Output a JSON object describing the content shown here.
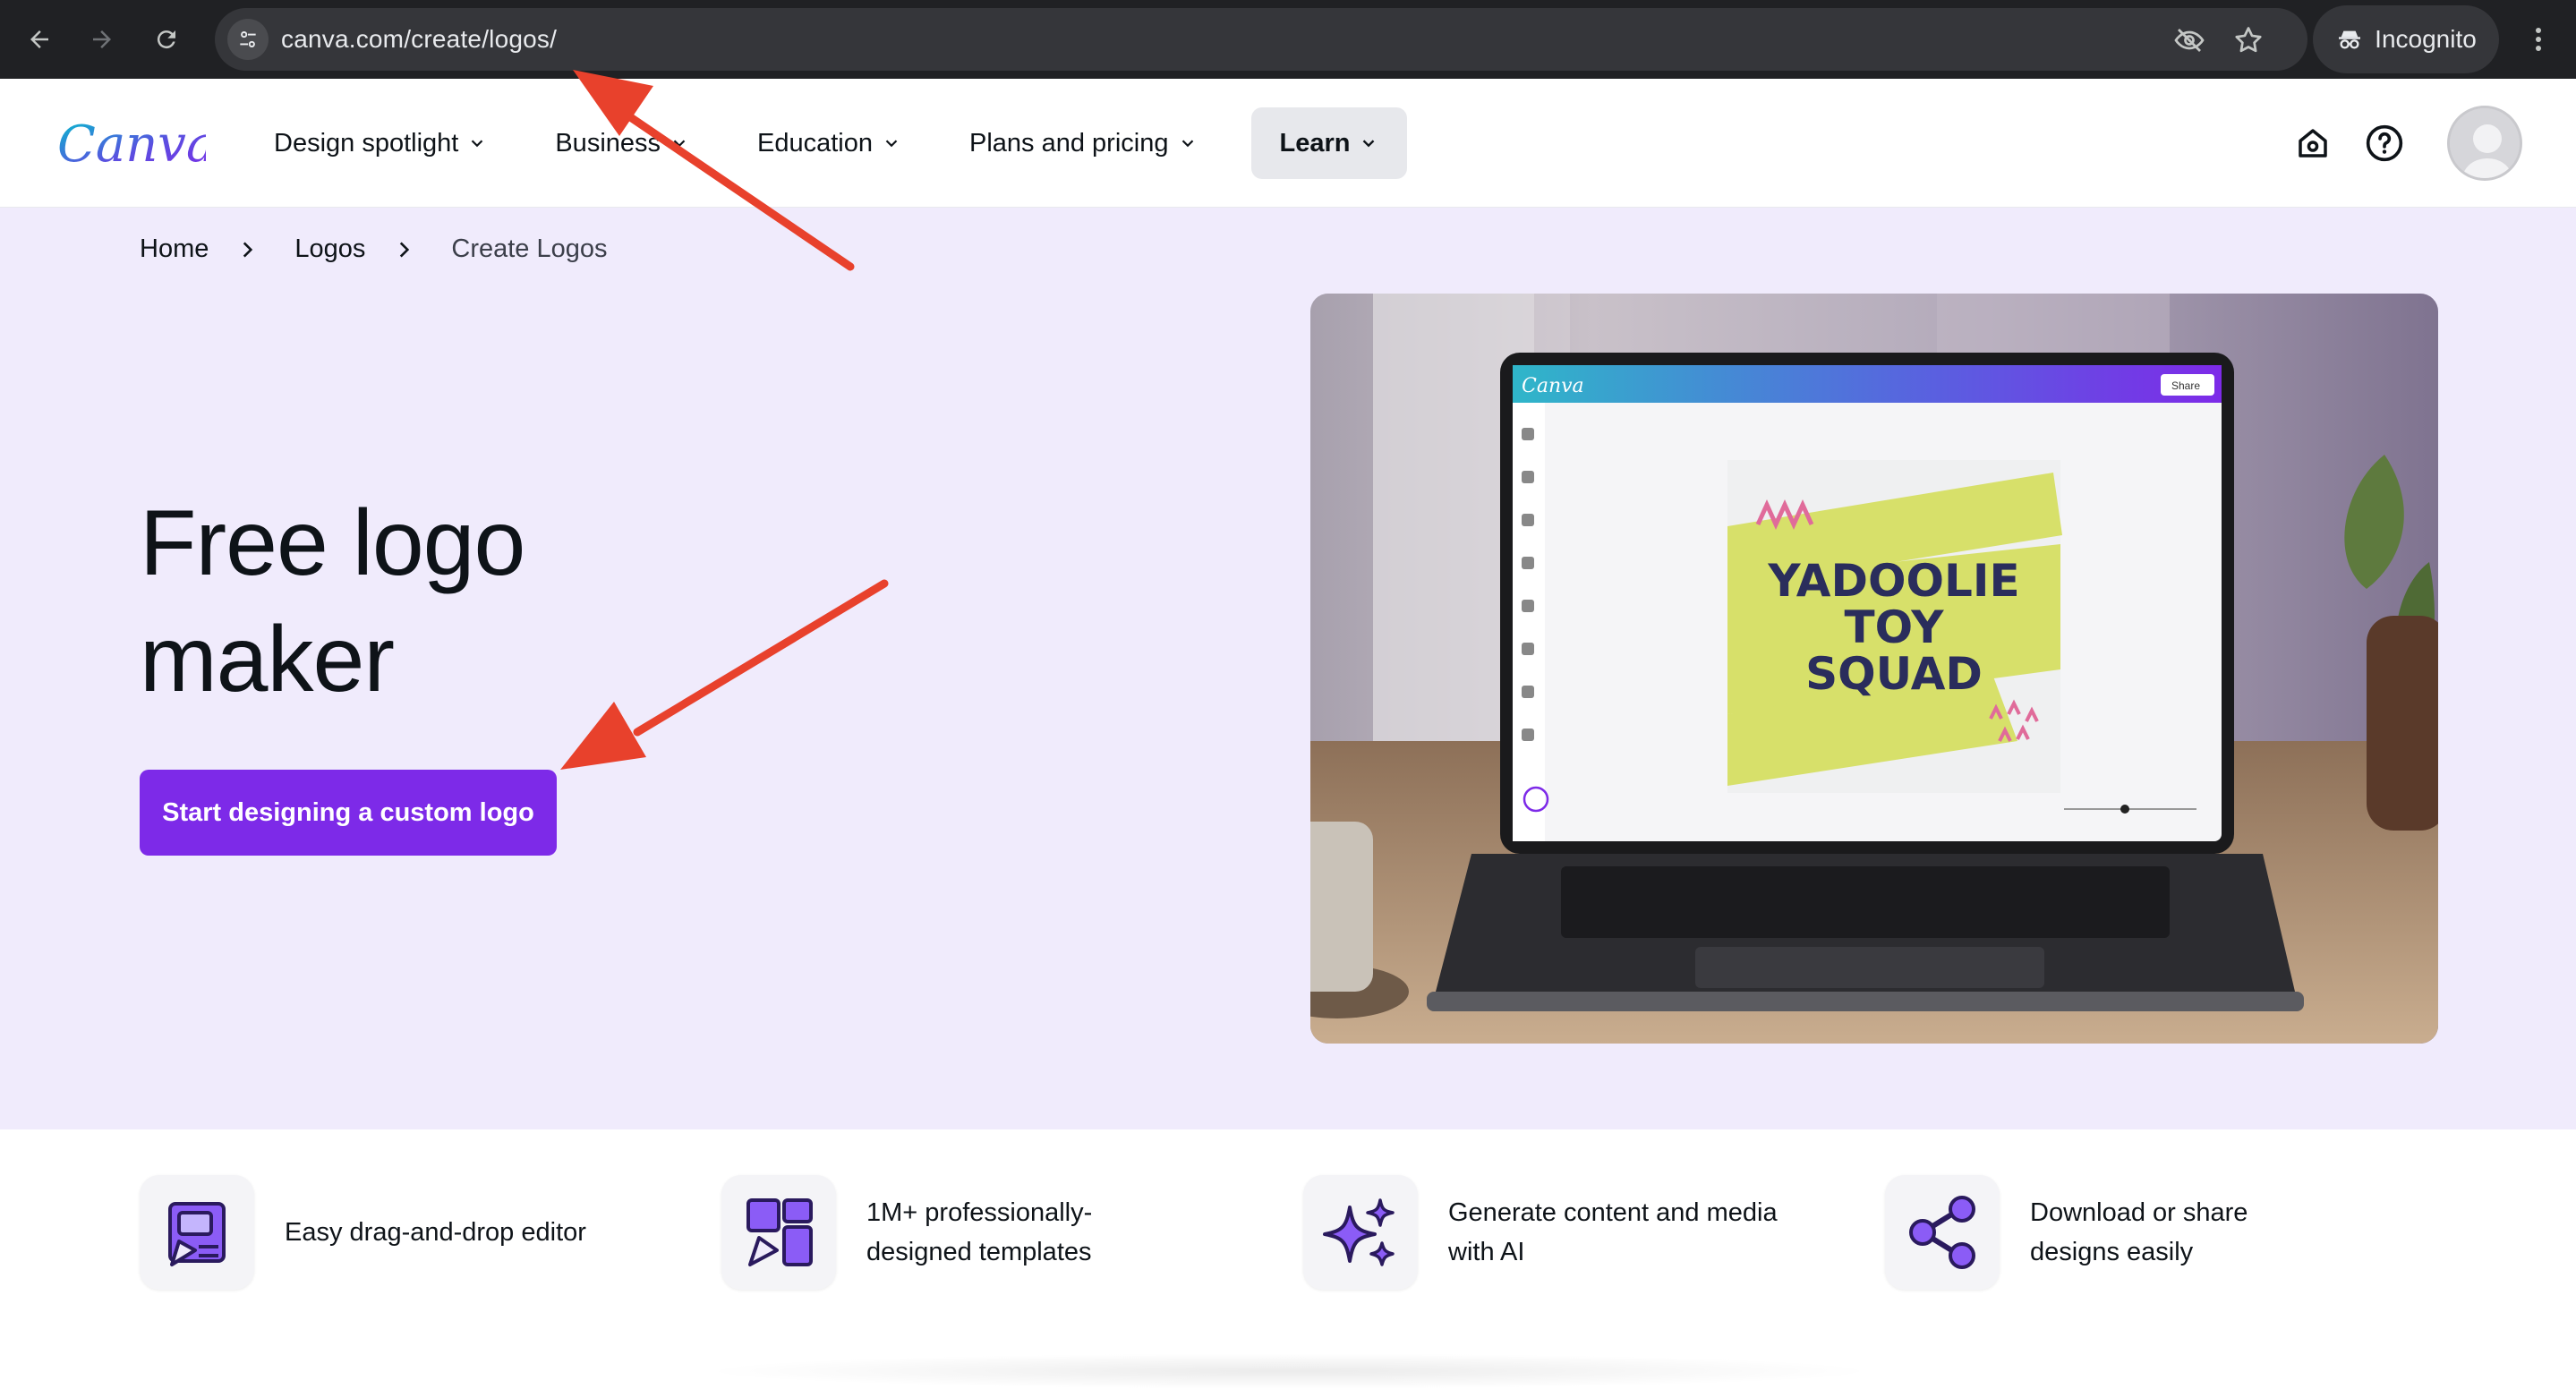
{
  "browser": {
    "url": "canva.com/create/logos/",
    "incognito_label": "Incognito"
  },
  "header": {
    "brand": "Canva",
    "menu": [
      {
        "label": "Design spotlight"
      },
      {
        "label": "Business"
      },
      {
        "label": "Education"
      },
      {
        "label": "Plans and pricing"
      },
      {
        "label": "Learn"
      }
    ]
  },
  "breadcrumb": [
    "Home",
    "Logos",
    "Create Logos"
  ],
  "hero": {
    "title_line1": "Free logo",
    "title_line2": "maker",
    "cta_label": "Start designing a custom logo"
  },
  "mockup": {
    "brand": "Canva",
    "share_label": "Share",
    "design_text": [
      "YADOOLIE",
      "TOY",
      "SQUAD"
    ],
    "colors": {
      "purple": "#7d2ae8",
      "teal": "#00c4cc",
      "lime": "#d7e06a",
      "navy": "#2a2d5c"
    }
  },
  "features": [
    {
      "text_line1": "Easy drag-and-drop editor",
      "text_line2": "",
      "icon": "drag-drop-icon"
    },
    {
      "text_line1": "1M+ professionally-",
      "text_line2": "designed templates",
      "icon": "templates-icon"
    },
    {
      "text_line1": "Generate content and media",
      "text_line2": "with AI",
      "icon": "sparkle-icon"
    },
    {
      "text_line1": "Download or share",
      "text_line2": "designs easily",
      "icon": "share-icon"
    }
  ],
  "colors": {
    "accent": "#7d2ae8",
    "hero_bg": "#f0ebfc",
    "chrome_bg": "#202124",
    "annotation": "#e8412c"
  }
}
